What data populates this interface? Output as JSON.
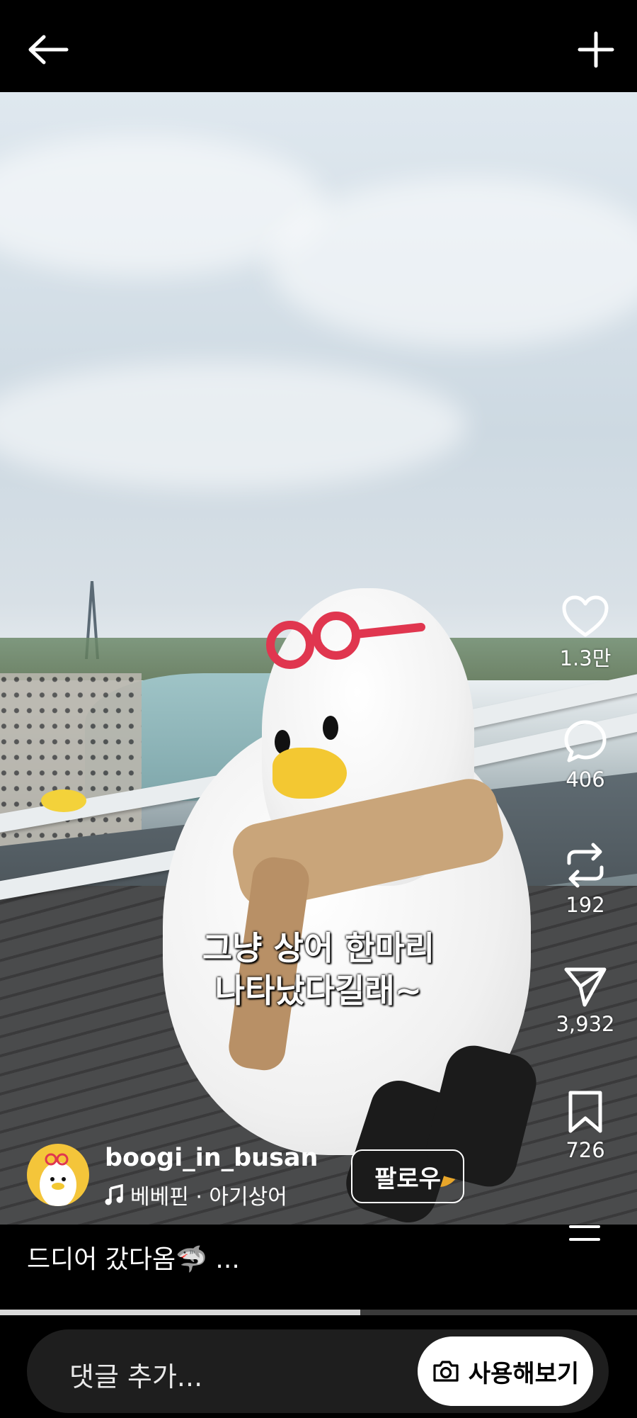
{
  "header": {
    "back_icon": "arrow-left-icon",
    "add_icon": "plus-icon"
  },
  "video": {
    "subtitle_line1": "그냥 상어 한마리",
    "subtitle_line2": "나타났다길래~",
    "progress": 0.565
  },
  "actions": {
    "like": {
      "icon": "heart-icon",
      "count": "1.3만"
    },
    "comment": {
      "icon": "speech-bubble-icon",
      "count": "406"
    },
    "repost": {
      "icon": "repost-icon",
      "count": "192"
    },
    "share": {
      "icon": "paper-plane-icon",
      "count": "3,932"
    },
    "save": {
      "icon": "bookmark-icon",
      "count": "726"
    }
  },
  "author": {
    "username": "boogi_in_busan",
    "music": "베베핀 · 아기상어",
    "follow_label": "팔로우"
  },
  "caption": {
    "text": "드디어 갔다옴🦈 ..."
  },
  "comment_bar": {
    "placeholder": "댓글 추가...",
    "try_label": "사용해보기"
  }
}
